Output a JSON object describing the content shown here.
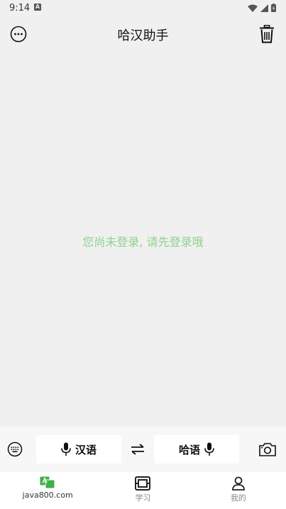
{
  "status": {
    "time": "9:14",
    "app_indicator": "A"
  },
  "header": {
    "title": "哈汉助手"
  },
  "main": {
    "empty_message": "您尚未登录, 请先登录哦"
  },
  "input_bar": {
    "source_lang": "汉语",
    "target_lang": "哈语"
  },
  "nav": {
    "items": [
      {
        "label": "java800.com",
        "icon": "translate-icon",
        "active": true
      },
      {
        "label": "学习",
        "icon": "study-icon",
        "active": false
      },
      {
        "label": "我的",
        "icon": "user-icon",
        "active": false
      }
    ]
  },
  "colors": {
    "accent": "#3cb043",
    "empty_message": "#8fd18f",
    "background": "#f0f0f0"
  }
}
